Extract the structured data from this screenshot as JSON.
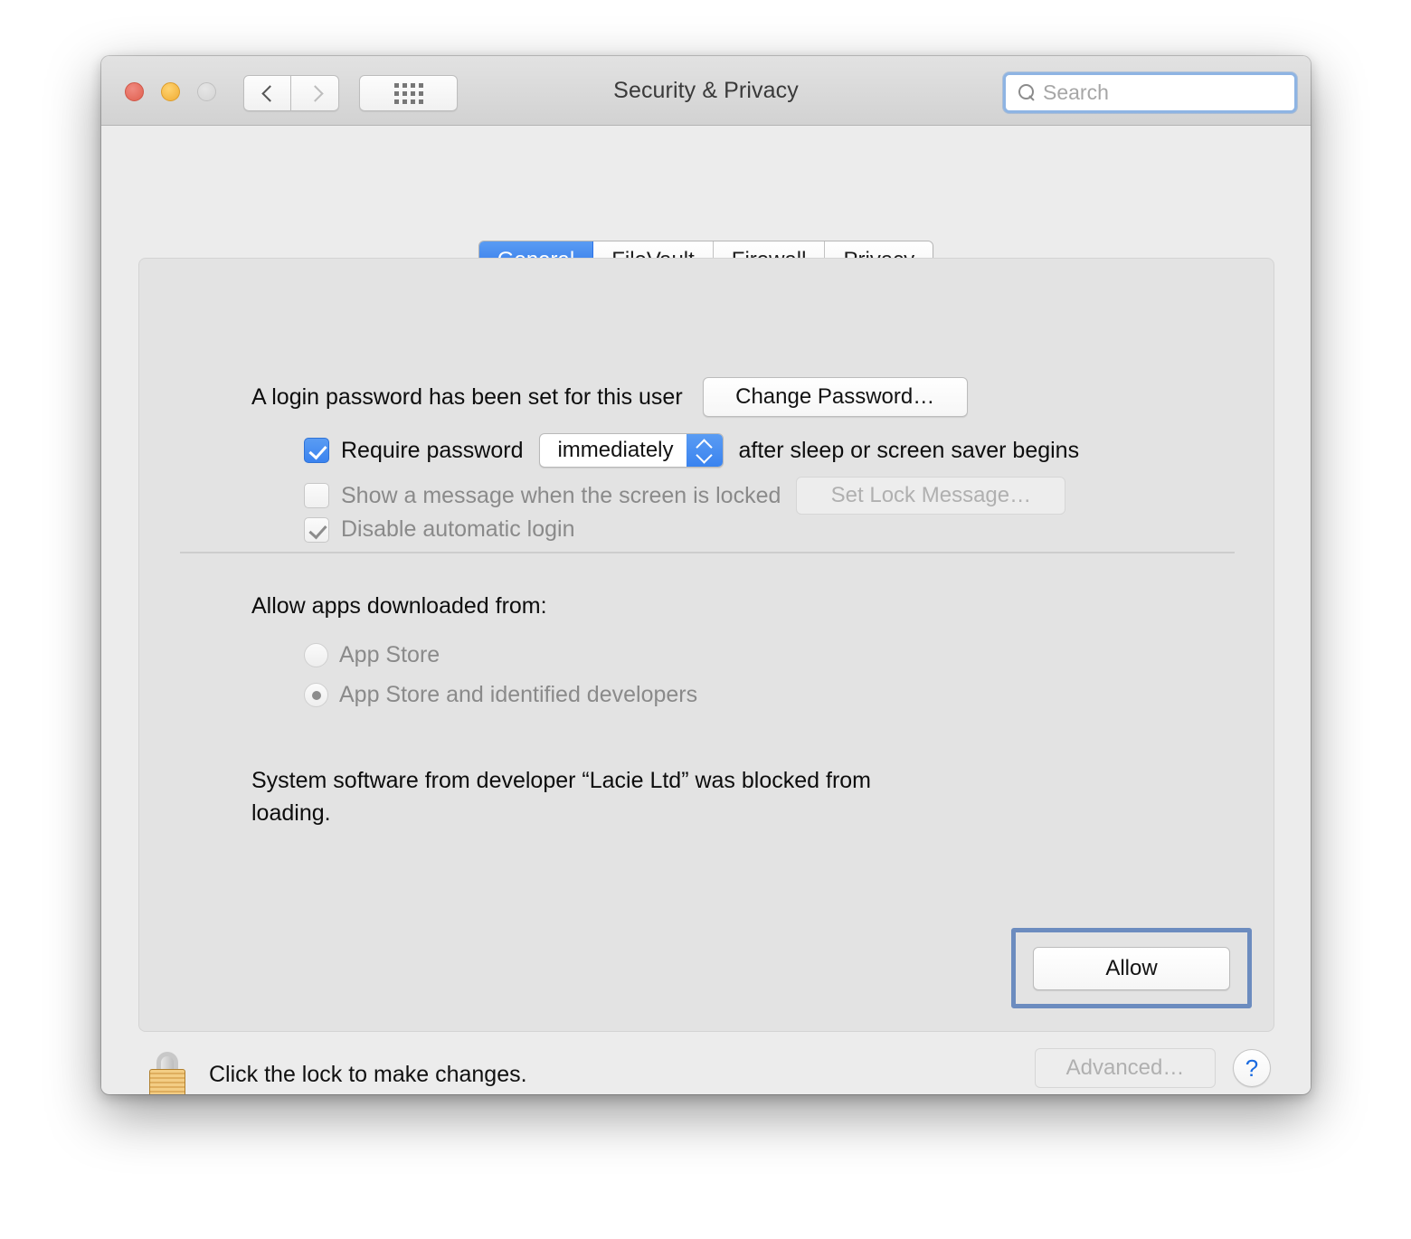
{
  "window": {
    "title": "Security & Privacy",
    "traffic_lights": [
      "close",
      "minimize",
      "zoom"
    ],
    "nav": {
      "back": "back-chevron",
      "forward": "forward-chevron"
    },
    "show_all": "grid-icon"
  },
  "search": {
    "placeholder": "Search",
    "value": "",
    "icon": "search-icon"
  },
  "tabs": [
    {
      "label": "General",
      "active": true
    },
    {
      "label": "FileVault",
      "active": false
    },
    {
      "label": "Firewall",
      "active": false
    },
    {
      "label": "Privacy",
      "active": false
    }
  ],
  "general": {
    "login_password_label": "A login password has been set for this user",
    "change_password_button": "Change Password…",
    "require_password": {
      "label": "Require password",
      "checked": true,
      "popup_value": "immediately",
      "suffix": "after sleep or screen saver begins"
    },
    "show_message": {
      "label": "Show a message when the screen is locked",
      "checked": false,
      "enabled": false,
      "button": "Set Lock Message…"
    },
    "disable_automatic_login": {
      "label": "Disable automatic login",
      "checked": true,
      "enabled": false
    },
    "allow_apps_label": "Allow apps downloaded from:",
    "radios": [
      {
        "label": "App Store",
        "selected": false,
        "enabled": false
      },
      {
        "label": "App Store and identified developers",
        "selected": true,
        "enabled": false
      }
    ],
    "blocked_notice": "System software from developer “Lacie Ltd” was blocked from loading.",
    "allow_button": "Allow"
  },
  "footer": {
    "lock_icon": "lock-closed-icon",
    "lock_text": "Click the lock to make changes.",
    "advanced_button": "Advanced…",
    "help_button": "?"
  },
  "colors": {
    "accent_blue": "#3a83ef",
    "focus_ring": "#6c8cbf",
    "search_focus": "#8eb4e3",
    "window_bg": "#ececec",
    "panel_bg": "#e3e3e3",
    "disabled_text": "#8a8a8a"
  }
}
